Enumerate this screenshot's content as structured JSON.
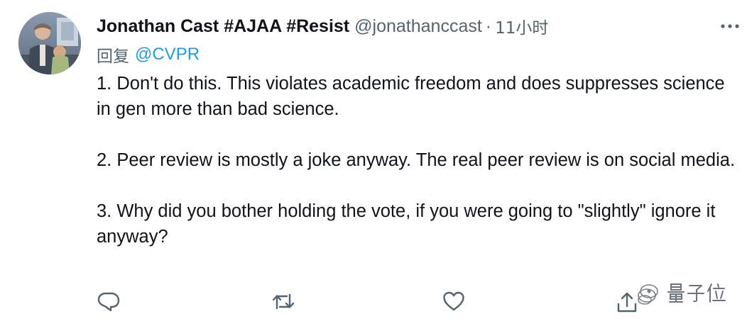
{
  "tweet": {
    "display_name": "Jonathan Cast #AJAA #Resist",
    "handle": "@jonathanccast",
    "separator": "·",
    "time": "11小时",
    "reply_prefix": "回复",
    "reply_mention": "@CVPR",
    "paragraphs": [
      "1. Don't do this. This violates academic freedom and does suppresses science in gen more than bad science.",
      "2. Peer review is mostly a joke anyway. The real peer review is on social media.",
      "3. Why did you bother holding the vote, if you were going to \"slightly\" ignore it anyway?"
    ]
  },
  "icons": {
    "more": "more-icon",
    "reply": "reply-icon",
    "retweet": "retweet-icon",
    "like": "like-icon",
    "share": "share-icon"
  },
  "watermark": {
    "text": "量子位"
  },
  "colors": {
    "text": "#0f1419",
    "secondary": "#536471",
    "link": "#1d9bf0"
  }
}
